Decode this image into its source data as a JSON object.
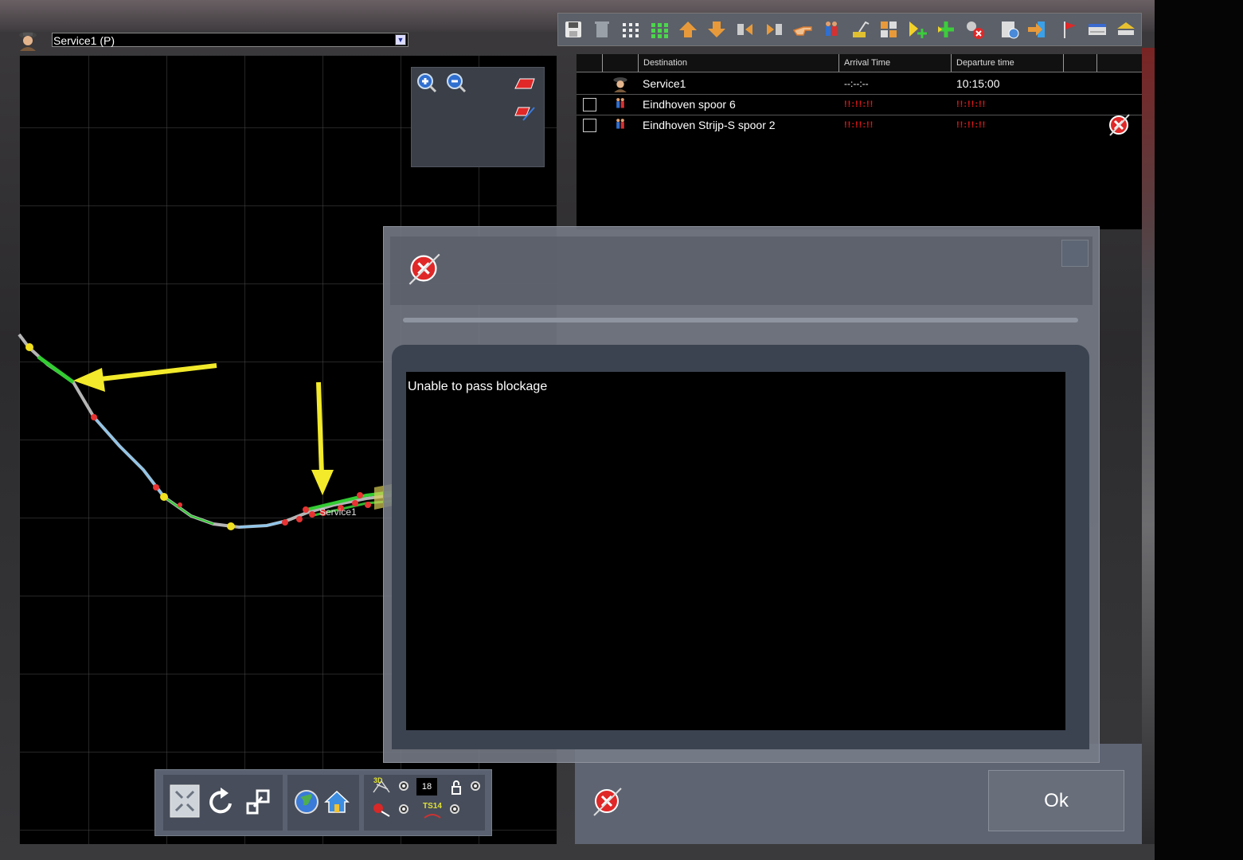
{
  "service_selector": {
    "selected": "Service1 (P)",
    "dropdown_arrow": "▼"
  },
  "toolbar": {
    "icons": [
      "save-icon",
      "trash-icon",
      "grid-small-icon",
      "grid-green-icon",
      "move-up-icon",
      "move-down-icon",
      "split-left-icon",
      "split-right-icon",
      "pointer-hand-icon",
      "passengers-icon",
      "crane-icon",
      "cargo-grid-icon",
      "add-waypoint-icon",
      "add-icon",
      "remove-stop-icon",
      "settings-icon",
      "export-icon",
      "flag-icon",
      "calendar-icon",
      "platform-icon"
    ]
  },
  "timetable": {
    "headers": {
      "destination": "Destination",
      "arrival": "Arrival Time",
      "departure": "Departure time"
    },
    "rows": [
      {
        "destination": "Service1",
        "arrival": "--:--:--",
        "departure": "10:15:00"
      },
      {
        "destination": "Eindhoven spoor 6",
        "arrival": "!!:!!:!!",
        "departure": "!!:!!:!!"
      },
      {
        "destination": "Eindhoven Strijp-S spoor 2",
        "arrival": "!!:!!:!!",
        "departure": "!!:!!:!!"
      }
    ]
  },
  "map": {
    "train_label": "Service1",
    "zoom_level": "18",
    "overlay_labels": {
      "view_3d": "3D",
      "ts_label": "TS14"
    }
  },
  "dialog": {
    "message": "Unable to pass blockage"
  },
  "footer": {
    "ok_label": "Ok"
  },
  "colors": {
    "track_gray": "#b5b5b5",
    "track_blue": "#8fc5ea",
    "track_green": "#33cc33",
    "signal_red": "#e83333",
    "marker_yellow": "#f0e020",
    "arrow_yellow": "#f2ea2a",
    "error_red": "#e01818"
  }
}
